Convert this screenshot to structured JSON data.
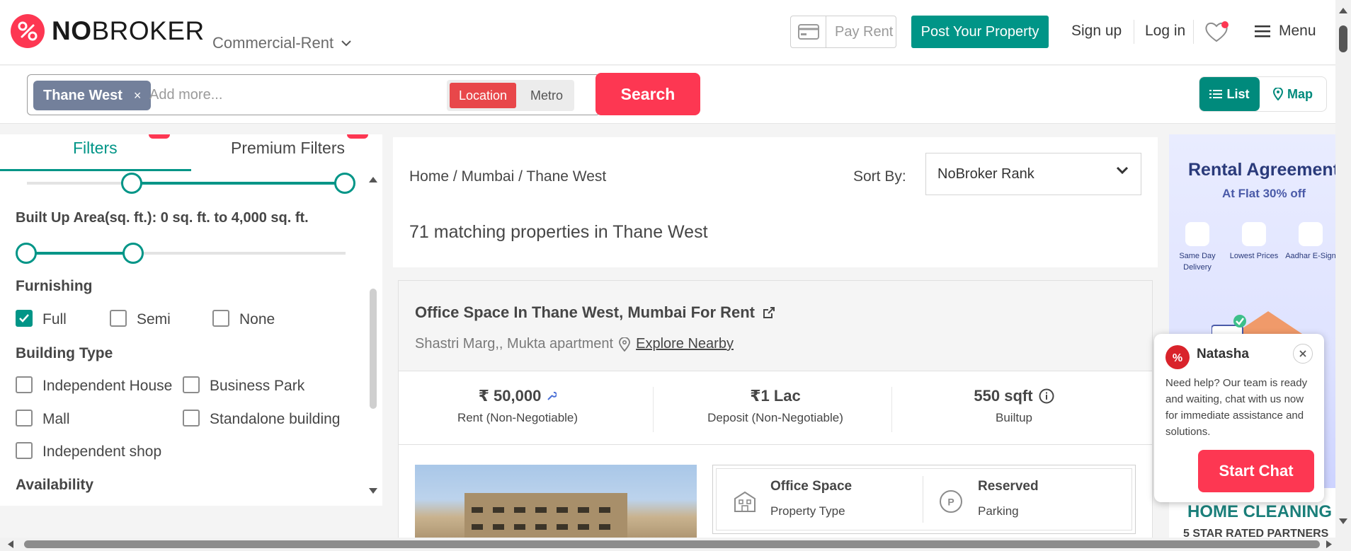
{
  "header": {
    "logo_no": "NO",
    "logo_broker": "BROKER",
    "category": "Commercial-Rent",
    "pay_rent": "Pay Rent",
    "post_property": "Post Your Property",
    "sign_up": "Sign up",
    "log_in": "Log in",
    "menu": "Menu"
  },
  "search": {
    "chip": "Thane West",
    "chip_remove": "×",
    "placeholder": "Add more...",
    "location": "Location",
    "metro": "Metro",
    "button": "Search",
    "view_list": "List",
    "view_map": "Map"
  },
  "filters": {
    "tab_filters": "Filters",
    "tab_premium": "Premium Filters",
    "built_up_label": "Built Up Area(sq. ft.): 0 sq. ft. to 4,000 sq. ft.",
    "furnishing_title": "Furnishing",
    "furnishing": [
      {
        "label": "Full",
        "checked": true
      },
      {
        "label": "Semi",
        "checked": false
      },
      {
        "label": "None",
        "checked": false
      }
    ],
    "building_title": "Building Type",
    "building": [
      {
        "label": "Independent House",
        "checked": false
      },
      {
        "label": "Business Park",
        "checked": false
      },
      {
        "label": "Mall",
        "checked": false
      },
      {
        "label": "Standalone building",
        "checked": false
      },
      {
        "label": "Independent shop",
        "checked": false
      }
    ],
    "availability_title": "Availability"
  },
  "results": {
    "breadcrumb": [
      "Home",
      "Mumbai",
      "Thane West"
    ],
    "sort_label": "Sort By:",
    "sort_value": "NoBroker Rank",
    "count_text": "71 matching properties in Thane West"
  },
  "listing": {
    "title": "Office Space In Thane West, Mumbai For Rent",
    "address": "Shastri Marg,, Mukta apartment",
    "explore": "Explore Nearby",
    "rent_value": "₹ 50,000",
    "rent_label": "Rent (Non-Negotiable)",
    "deposit_value": "₹1 Lac",
    "deposit_label": "Deposit (Non-Negotiable)",
    "area_value": "550 sqft",
    "area_label": "Builtup",
    "attr1_title": "Office Space",
    "attr1_sub": "Property Type",
    "attr2_title": "Reserved",
    "attr2_sub": "Parking"
  },
  "ad": {
    "title": "Rental Agreement",
    "subtitle": "At Flat 30% off",
    "features": [
      "Same Day Delivery",
      "Lowest Prices",
      "Aadhar E-Sign"
    ],
    "bottom": "HOME CLEANING",
    "bottom2": "5 STAR RATED PARTNERS"
  },
  "chat": {
    "name": "Natasha",
    "message": "Need help? Our team is ready and waiting, chat with us now for immediate assistance and solutions.",
    "button": "Start Chat"
  },
  "colors": {
    "brand": "#fd3752",
    "teal": "#009587",
    "chip": "#73809b"
  }
}
